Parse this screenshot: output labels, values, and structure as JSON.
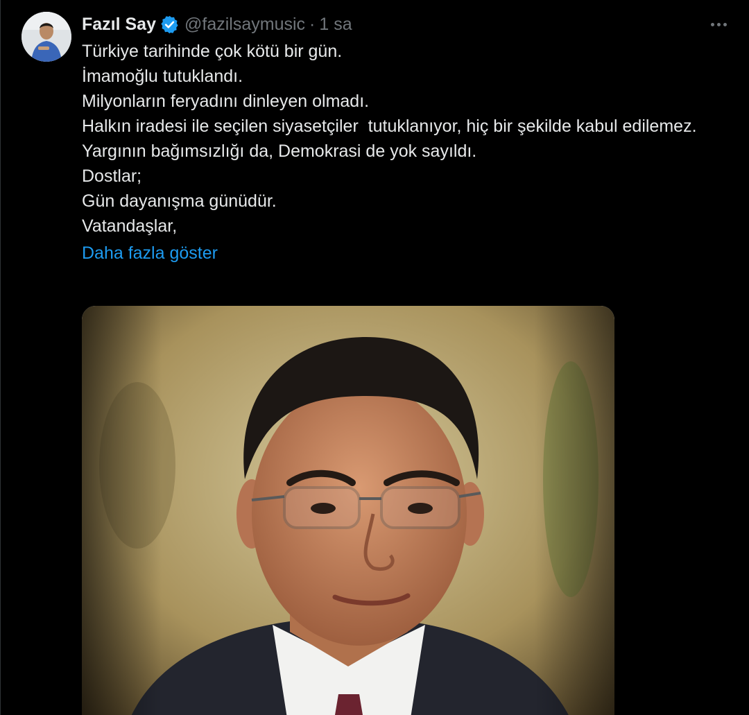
{
  "tweet": {
    "display_name": "Fazıl Say",
    "verified_icon": "verified-badge-icon",
    "handle": "@fazilsaymusic",
    "separator": "·",
    "timestamp": "1 sa",
    "more_icon": "more-options-icon",
    "lines": [
      "Türkiye tarihinde çok kötü bir gün.",
      "İmamoğlu tutuklandı.",
      "Milyonların feryadını dinleyen olmadı.",
      "Halkın iradesi ile seçilen siyasetçiler  tutuklanıyor, hiç bir şekilde kabul edilemez.",
      "Yargının bağımsızlığı da, Demokrasi de yok sayıldı.",
      "Dostlar;",
      "Gün dayanışma günüdür.",
      "Vatandaşlar,"
    ],
    "show_more": "Daha fazla göster"
  },
  "colors": {
    "background": "#000000",
    "text": "#e7e9ea",
    "muted": "#71767b",
    "link": "#1d9bf0",
    "verified": "#1d9bf0"
  }
}
